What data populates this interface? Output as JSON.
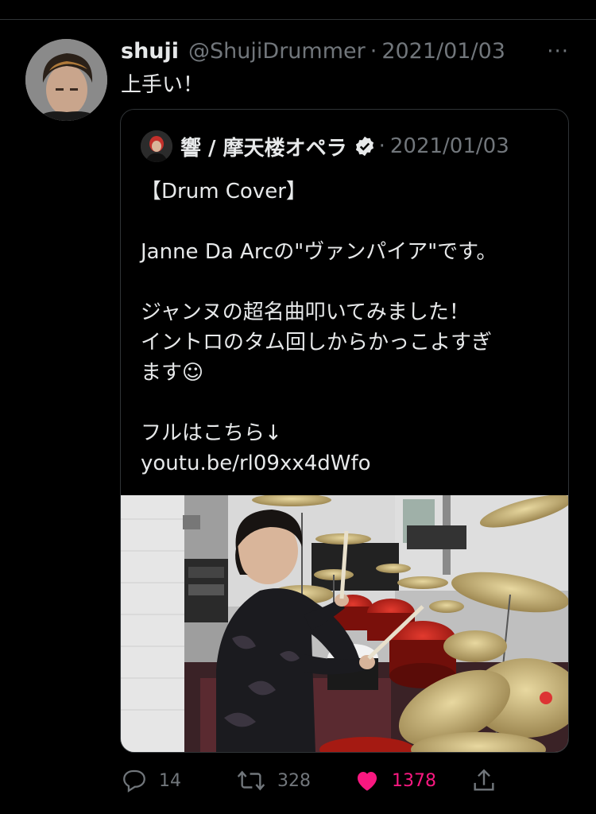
{
  "tweet": {
    "author_name": "shuji",
    "author_handle": "@ShujiDrummer",
    "separator": "·",
    "date": "2021/01/03",
    "more_label": "···",
    "text": "上手い！"
  },
  "quoted": {
    "author_name": "響 / 摩天楼オペラ",
    "separator": "·",
    "date": "2021/01/03",
    "lines": [
      "【Drum Cover】",
      "",
      "Janne Da Arcの\"ヴァンパイア\"です。",
      "",
      "ジャンヌの超名曲叩いてみました！",
      "イントロのタム回しからかっこよすぎ",
      "ます☺",
      "",
      "フルはこちら↓",
      "youtu.be/rl09xx4dWfo"
    ]
  },
  "actions": {
    "reply_count": "14",
    "retweet_count": "328",
    "like_count": "1378"
  },
  "colors": {
    "background": "#000000",
    "text": "#e7e9ea",
    "muted": "#71767b",
    "border": "#2f3336",
    "like": "#f91880"
  }
}
